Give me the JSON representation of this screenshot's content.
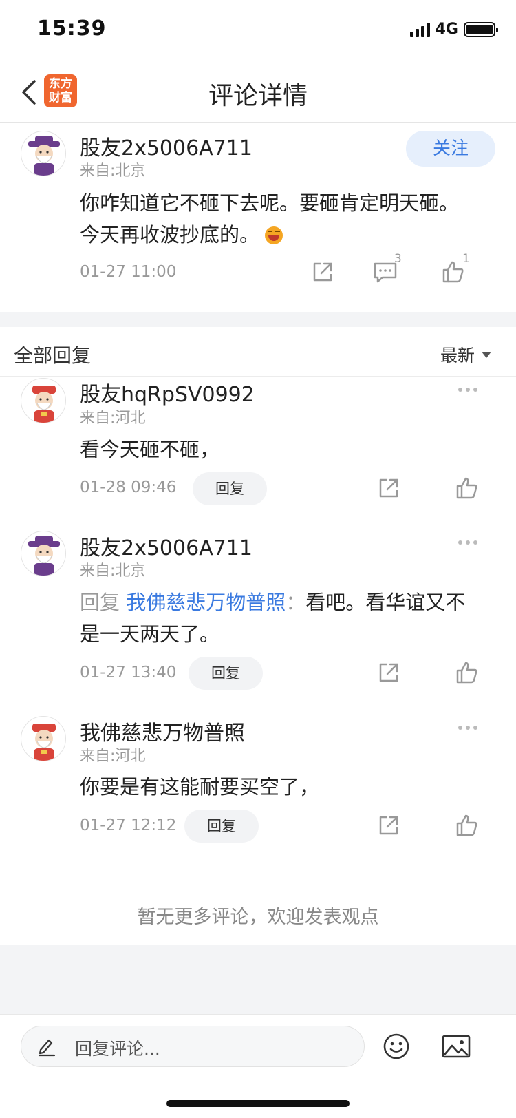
{
  "status": {
    "time": "15:39",
    "network": "4G"
  },
  "nav": {
    "title": "评论详情",
    "logo_line1": "东方",
    "logo_line2": "财富"
  },
  "main_comment": {
    "user": "股友2x5006A711",
    "location": "来自:北京",
    "follow_label": "关注",
    "content_line1": "你咋知道它不砸下去呢。要砸肯定明天砸。",
    "content_line2": "今天再收波抄底的。",
    "time": "01-27 11:00",
    "comment_count": "3",
    "like_count": "1"
  },
  "replies_header": {
    "title": "全部回复",
    "sort_label": "最新"
  },
  "replies": [
    {
      "user": "股友hqRpSV0992",
      "location": "来自:河北",
      "content": "看今天砸不砸，",
      "time": "01-28 09:46",
      "reply_label": "回复"
    },
    {
      "user": "股友2x5006A711",
      "location": "来自:北京",
      "quote_prefix": "回复 ",
      "quote_user": "我佛慈悲万物普照",
      "quote_sep": "：",
      "content_line1": "看吧。看华谊又不",
      "content_line2": "是一天两天了。",
      "time": "01-27 13:40",
      "reply_label": "回复"
    },
    {
      "user": "我佛慈悲万物普照",
      "location": "来自:河北",
      "content": "你要是有这能耐要买空了，",
      "time": "01-27 12:12",
      "reply_label": "回复"
    }
  ],
  "footer": {
    "no_more": "暂无更多评论，欢迎发表观点",
    "input_placeholder": "回复评论..."
  }
}
